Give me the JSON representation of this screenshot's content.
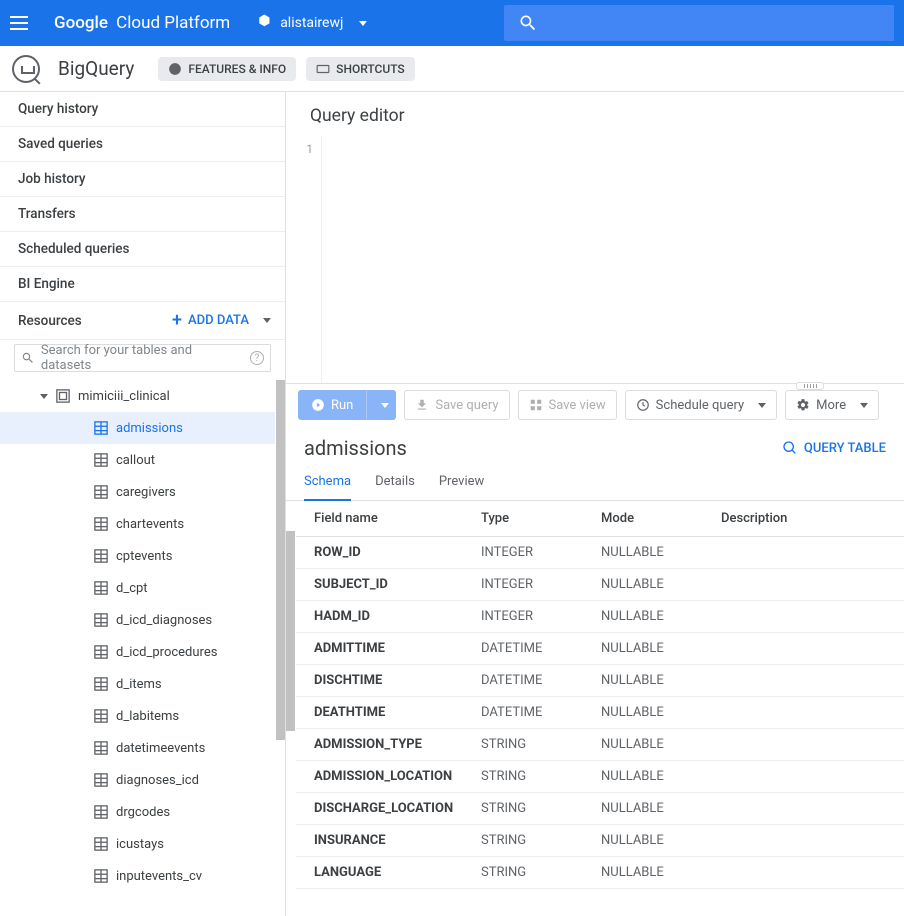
{
  "topbar": {
    "brand_prefix": "Google",
    "brand_suffix": "Cloud Platform",
    "project_name": "alistairewj"
  },
  "subheader": {
    "title": "BigQuery",
    "chip_features": "FEATURES & INFO",
    "chip_shortcuts": "SHORTCUTS"
  },
  "sidebar": {
    "links": [
      "Query history",
      "Saved queries",
      "Job history",
      "Transfers",
      "Scheduled queries",
      "BI Engine"
    ],
    "resources_label": "Resources",
    "add_data_label": "ADD DATA",
    "search_placeholder": "Search for your tables and datasets",
    "dataset": "mimiciii_clinical",
    "tables": [
      "admissions",
      "callout",
      "caregivers",
      "chartevents",
      "cptevents",
      "d_cpt",
      "d_icd_diagnoses",
      "d_icd_procedures",
      "d_items",
      "d_labitems",
      "datetimeevents",
      "diagnoses_icd",
      "drgcodes",
      "icustays",
      "inputevents_cv"
    ],
    "selected_table": "admissions"
  },
  "editor": {
    "title": "Query editor",
    "line_number": "1",
    "run_label": "Run",
    "save_query_label": "Save query",
    "save_view_label": "Save view",
    "schedule_query_label": "Schedule query",
    "more_label": "More"
  },
  "detail": {
    "title": "admissions",
    "query_table_label": "QUERY TABLE",
    "tabs": [
      "Schema",
      "Details",
      "Preview"
    ],
    "active_tab": "Schema",
    "columns": [
      "Field name",
      "Type",
      "Mode",
      "Description"
    ],
    "rows": [
      {
        "field": "ROW_ID",
        "type": "INTEGER",
        "mode": "NULLABLE",
        "desc": ""
      },
      {
        "field": "SUBJECT_ID",
        "type": "INTEGER",
        "mode": "NULLABLE",
        "desc": ""
      },
      {
        "field": "HADM_ID",
        "type": "INTEGER",
        "mode": "NULLABLE",
        "desc": ""
      },
      {
        "field": "ADMITTIME",
        "type": "DATETIME",
        "mode": "NULLABLE",
        "desc": ""
      },
      {
        "field": "DISCHTIME",
        "type": "DATETIME",
        "mode": "NULLABLE",
        "desc": ""
      },
      {
        "field": "DEATHTIME",
        "type": "DATETIME",
        "mode": "NULLABLE",
        "desc": ""
      },
      {
        "field": "ADMISSION_TYPE",
        "type": "STRING",
        "mode": "NULLABLE",
        "desc": ""
      },
      {
        "field": "ADMISSION_LOCATION",
        "type": "STRING",
        "mode": "NULLABLE",
        "desc": ""
      },
      {
        "field": "DISCHARGE_LOCATION",
        "type": "STRING",
        "mode": "NULLABLE",
        "desc": ""
      },
      {
        "field": "INSURANCE",
        "type": "STRING",
        "mode": "NULLABLE",
        "desc": ""
      },
      {
        "field": "LANGUAGE",
        "type": "STRING",
        "mode": "NULLABLE",
        "desc": ""
      }
    ]
  }
}
